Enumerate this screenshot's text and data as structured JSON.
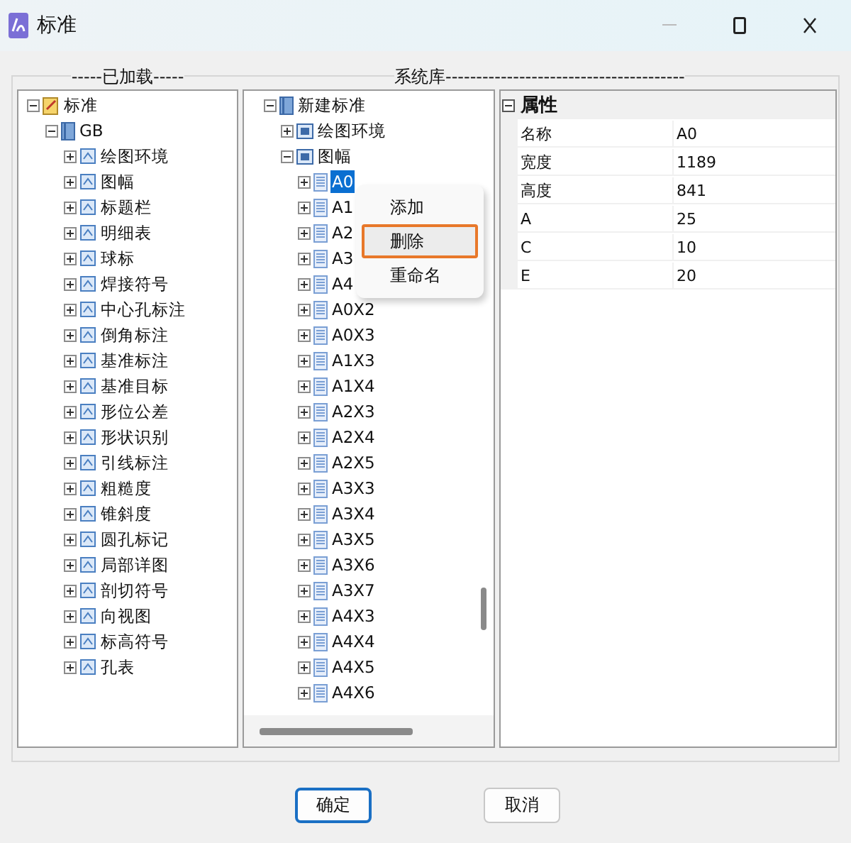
{
  "window": {
    "title": "标准"
  },
  "loaded_panel": {
    "label": "-----已加载-----",
    "tree": [
      {
        "label": "标准",
        "expanded": true,
        "selected": false,
        "children": [
          {
            "label": "GB",
            "expanded": true,
            "selected": false,
            "children": [
              {
                "label": "绘图环境",
                "expanded": false,
                "selected": false
              },
              {
                "label": "图幅",
                "expanded": false,
                "selected": false
              },
              {
                "label": "标题栏",
                "expanded": false,
                "selected": false
              },
              {
                "label": "明细表",
                "expanded": false,
                "selected": false
              },
              {
                "label": "球标",
                "expanded": false,
                "selected": false
              },
              {
                "label": "焊接符号",
                "expanded": false,
                "selected": false
              },
              {
                "label": "中心孔标注",
                "expanded": false,
                "selected": false
              },
              {
                "label": "倒角标注",
                "expanded": false,
                "selected": false
              },
              {
                "label": "基准标注",
                "expanded": false,
                "selected": false
              },
              {
                "label": "基准目标",
                "expanded": false,
                "selected": false
              },
              {
                "label": "形位公差",
                "expanded": false,
                "selected": false
              },
              {
                "label": "形状识别",
                "expanded": false,
                "selected": false
              },
              {
                "label": "引线标注",
                "expanded": false,
                "selected": false
              },
              {
                "label": "粗糙度",
                "expanded": false,
                "selected": false
              },
              {
                "label": "锥斜度",
                "expanded": false,
                "selected": false
              },
              {
                "label": "圆孔标记",
                "expanded": false,
                "selected": false
              },
              {
                "label": "局部详图",
                "expanded": false,
                "selected": false
              },
              {
                "label": "剖切符号",
                "expanded": false,
                "selected": false
              },
              {
                "label": "向视图",
                "expanded": false,
                "selected": false
              },
              {
                "label": "标高符号",
                "expanded": false,
                "selected": false
              },
              {
                "label": "孔表",
                "expanded": false,
                "selected": false
              }
            ]
          }
        ]
      }
    ]
  },
  "library_panel": {
    "label": "系统库---------------------------------------",
    "tree": [
      {
        "label": "新建标准",
        "expanded": true,
        "selected": false,
        "children": [
          {
            "label": "绘图环境",
            "expanded": false,
            "selected": false
          },
          {
            "label": "图幅",
            "expanded": true,
            "selected": false,
            "children": [
              {
                "label": "A0",
                "expanded": false,
                "selected": true
              },
              {
                "label": "A1",
                "expanded": false,
                "selected": false
              },
              {
                "label": "A2",
                "expanded": false,
                "selected": false
              },
              {
                "label": "A3",
                "expanded": false,
                "selected": false
              },
              {
                "label": "A4",
                "expanded": false,
                "selected": false
              },
              {
                "label": "A0X2",
                "expanded": false,
                "selected": false
              },
              {
                "label": "A0X3",
                "expanded": false,
                "selected": false
              },
              {
                "label": "A1X3",
                "expanded": false,
                "selected": false
              },
              {
                "label": "A1X4",
                "expanded": false,
                "selected": false
              },
              {
                "label": "A2X3",
                "expanded": false,
                "selected": false
              },
              {
                "label": "A2X4",
                "expanded": false,
                "selected": false
              },
              {
                "label": "A2X5",
                "expanded": false,
                "selected": false
              },
              {
                "label": "A3X3",
                "expanded": false,
                "selected": false
              },
              {
                "label": "A3X4",
                "expanded": false,
                "selected": false
              },
              {
                "label": "A3X5",
                "expanded": false,
                "selected": false
              },
              {
                "label": "A3X6",
                "expanded": false,
                "selected": false
              },
              {
                "label": "A3X7",
                "expanded": false,
                "selected": false
              },
              {
                "label": "A4X3",
                "expanded": false,
                "selected": false
              },
              {
                "label": "A4X4",
                "expanded": false,
                "selected": false
              },
              {
                "label": "A4X5",
                "expanded": false,
                "selected": false
              },
              {
                "label": "A4X6",
                "expanded": false,
                "selected": false
              }
            ]
          }
        ]
      }
    ]
  },
  "context_menu": {
    "items": [
      {
        "label": "添加",
        "selected": false
      },
      {
        "label": "删除",
        "selected": true
      },
      {
        "label": "重命名",
        "selected": false
      }
    ]
  },
  "properties": {
    "section": "属性",
    "expanded": true,
    "rows": [
      {
        "name": "名称",
        "value": "A0"
      },
      {
        "name": "宽度",
        "value": "1189"
      },
      {
        "name": "高度",
        "value": "841"
      },
      {
        "name": "A",
        "value": "25"
      },
      {
        "name": "C",
        "value": "10"
      },
      {
        "name": "E",
        "value": "20"
      }
    ]
  },
  "buttons": [
    {
      "label": "确定",
      "default": true
    },
    {
      "label": "取消",
      "default": false
    }
  ]
}
